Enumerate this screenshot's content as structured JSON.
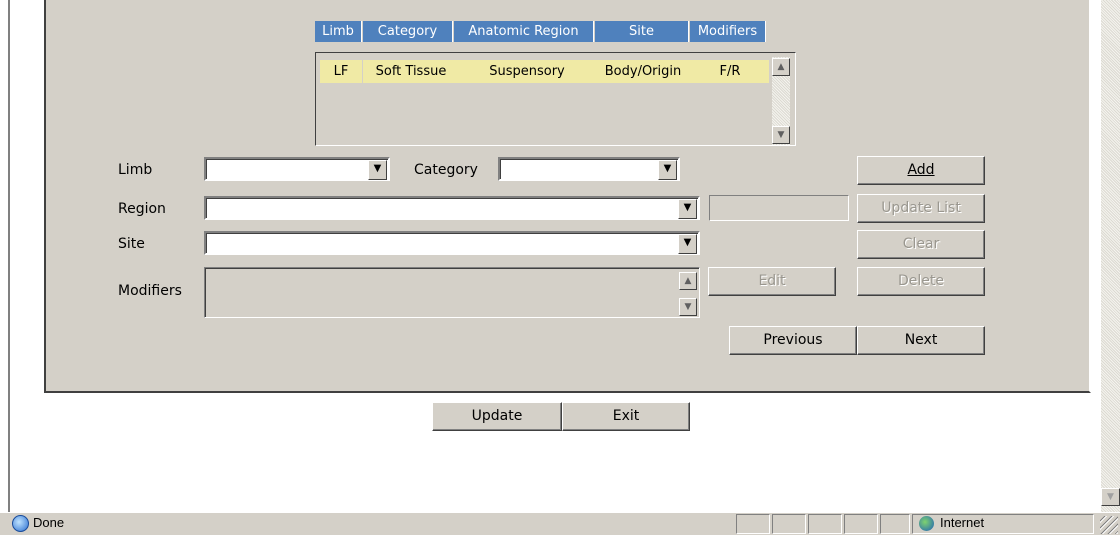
{
  "grid": {
    "headers": [
      "Limb",
      "Category",
      "Anatomic Region",
      "Site",
      "Modifiers"
    ],
    "rows": [
      [
        "LF",
        "Soft Tissue",
        "Suspensory",
        "Body/Origin",
        "F/R"
      ]
    ]
  },
  "form": {
    "limb_label": "Limb",
    "category_label": "Category",
    "region_label": "Region",
    "site_label": "Site",
    "modifiers_label": "Modifiers"
  },
  "buttons": {
    "add": "Add",
    "update_list": "Update List",
    "clear": "Clear",
    "delete": "Delete",
    "edit": "Edit",
    "previous": "Previous",
    "next": "Next",
    "update": "Update",
    "exit": "Exit"
  },
  "statusbar": {
    "status_text": "Done",
    "zone_text": "Internet"
  },
  "icons": {
    "combo_arrow": "▼",
    "scroll_up": "▲",
    "scroll_down": "▼"
  }
}
